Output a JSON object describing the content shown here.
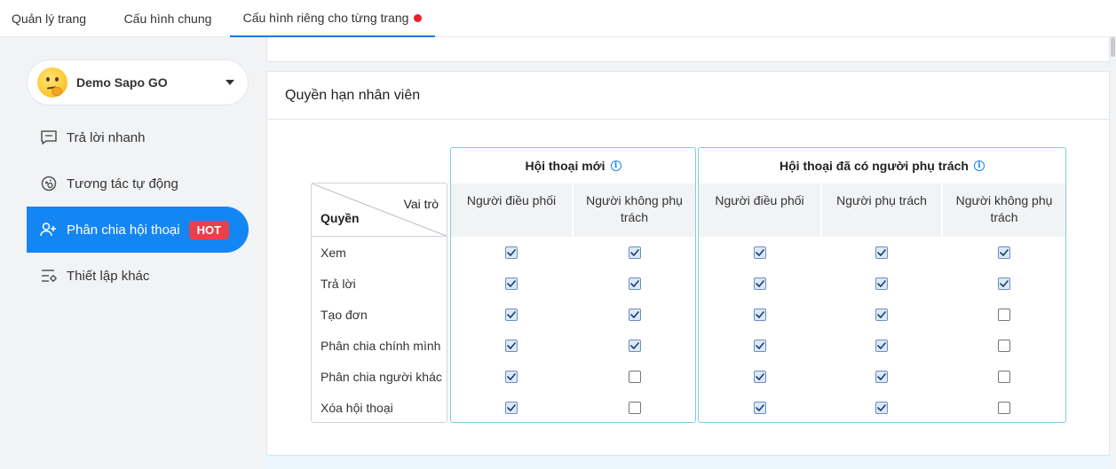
{
  "tabs": [
    {
      "label": "Quản lý trang",
      "active": false
    },
    {
      "label": "Cấu hình chung",
      "active": false
    },
    {
      "label": "Cấu hình riêng cho từng trang",
      "active": true,
      "has_dot": true
    }
  ],
  "sidebar": {
    "page_name": "Demo Sapo GO",
    "items": [
      {
        "label": "Trả lời nhanh",
        "icon": "chat-bubble-icon",
        "active": false
      },
      {
        "label": "Tương tác tự động",
        "icon": "gear-bot-icon",
        "active": false
      },
      {
        "label": "Phân chia hội thoại",
        "icon": "add-user-icon",
        "active": true,
        "badge": "HOT"
      },
      {
        "label": "Thiết lập khác",
        "icon": "settings-list-icon",
        "active": false
      }
    ]
  },
  "card": {
    "title": "Quyền hạn nhân viên",
    "role_label": "Vai trò",
    "permission_label": "Quyền",
    "permissions": [
      "Xem",
      "Trả lời",
      "Tạo đơn",
      "Phân chia chính mình",
      "Phân chia người khác",
      "Xóa hội thoại"
    ],
    "groups": [
      {
        "title": "Hội thoại mới",
        "columns": [
          {
            "label": "Người điều phối",
            "checks": [
              true,
              true,
              true,
              true,
              true,
              true
            ]
          },
          {
            "label": "Người không phụ trách",
            "checks": [
              true,
              true,
              true,
              true,
              false,
              false
            ]
          }
        ]
      },
      {
        "title": "Hội thoại đã có người phụ trách",
        "columns": [
          {
            "label": "Người điều phối",
            "checks": [
              true,
              true,
              true,
              true,
              true,
              true
            ]
          },
          {
            "label": "Người phụ trách",
            "checks": [
              true,
              true,
              true,
              true,
              true,
              true
            ]
          },
          {
            "label": "Người không phụ trách",
            "checks": [
              true,
              true,
              false,
              false,
              false,
              false
            ]
          }
        ]
      }
    ]
  },
  "colors": {
    "accent": "#1486f4",
    "hot_badge": "#e8414b",
    "tab_dot": "#e8202a",
    "group_border": "#7fcbe5"
  }
}
